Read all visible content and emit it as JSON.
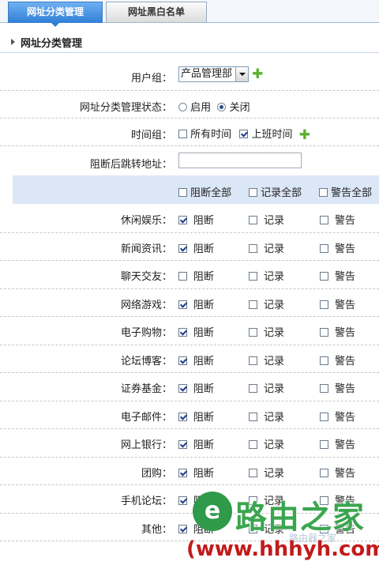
{
  "tabs": [
    {
      "label": "网址分类管理",
      "active": true
    },
    {
      "label": "网址黑白名单",
      "active": false
    }
  ],
  "section_title": "网址分类管理",
  "form": {
    "user_group": {
      "label": "用户组：",
      "value": "产品管理部"
    },
    "status": {
      "label": "网址分类管理状态：",
      "options": [
        "启用",
        "关闭"
      ],
      "selected": "关闭"
    },
    "time_group": {
      "label": "时间组：",
      "options": [
        {
          "text": "所有时间",
          "checked": false
        },
        {
          "text": "上班时间",
          "checked": true
        }
      ]
    },
    "redirect": {
      "label": "阻断后跳转地址：",
      "value": ""
    }
  },
  "header": {
    "block_all": "阻断全部",
    "record_all": "记录全部",
    "warn_all": "警告全部"
  },
  "action_labels": {
    "block": "阻断",
    "record": "记录",
    "warn": "警告"
  },
  "categories": [
    {
      "name": "休闲娱乐：",
      "block": true,
      "record": false,
      "warn": false
    },
    {
      "name": "新闻资讯：",
      "block": true,
      "record": false,
      "warn": false
    },
    {
      "name": "聊天交友：",
      "block": false,
      "record": false,
      "warn": false
    },
    {
      "name": "网络游戏：",
      "block": true,
      "record": false,
      "warn": false
    },
    {
      "name": "电子购物：",
      "block": true,
      "record": false,
      "warn": false
    },
    {
      "name": "论坛博客：",
      "block": true,
      "record": false,
      "warn": false
    },
    {
      "name": "证券基金：",
      "block": true,
      "record": false,
      "warn": false
    },
    {
      "name": "电子邮件：",
      "block": true,
      "record": false,
      "warn": false
    },
    {
      "name": "网上银行：",
      "block": true,
      "record": false,
      "warn": false
    },
    {
      "name": "团购：",
      "block": true,
      "record": false,
      "warn": false
    },
    {
      "name": "手机论坛：",
      "block": true,
      "record": false,
      "warn": false
    },
    {
      "name": "其他：",
      "block": true,
      "record": false,
      "warn": false
    }
  ],
  "watermark": {
    "logo_char": "e",
    "brand": "路由之家",
    "url": "(www.hhhyh.com)",
    "faint": "路由器之家"
  },
  "icons": {
    "add": "plus-icon",
    "section": "triangle-right-icon",
    "dropdown": "chevron-down-icon"
  }
}
